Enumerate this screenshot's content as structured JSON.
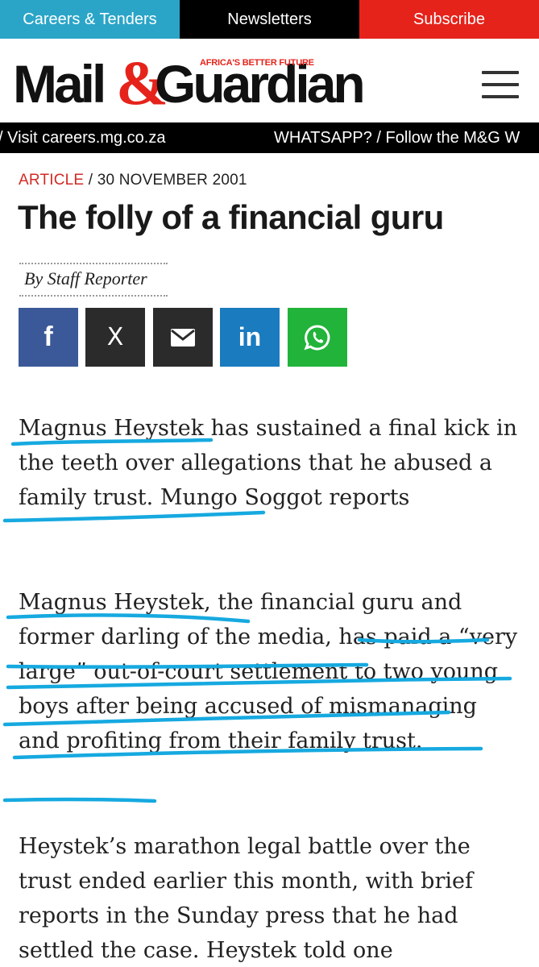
{
  "topbar": {
    "careers": "Careers & Tenders",
    "newsletters": "Newsletters",
    "subscribe": "Subscribe"
  },
  "header": {
    "logo_mail": "Mail",
    "logo_amp": "&",
    "logo_guardian": "Guardian",
    "tagline": "AFRICA'S BETTER FUTURE"
  },
  "ticker": {
    "item1": "/ Visit careers.mg.co.za",
    "item2": "WHATSAPP? / Follow the M&G W"
  },
  "article": {
    "kind": "ARTICLE",
    "separator": "/",
    "date": "30 NOVEMBER 2001",
    "title": "The folly of a financial guru",
    "byline": "By Staff Reporter",
    "paragraphs": [
      "Magnus Heystek has sustained a final kick in the teeth over allegations that he abused a family trust. Mungo Soggot reports",
      "Magnus Heystek, the financial guru and former darling of the media, has paid a “very large” out-of-court settlement to two young boys after being accused of mismanaging and profiting from their family trust.",
      "Heystek’s marathon legal battle over the trust ended earlier this month, with brief reports in the Sunday press that he had settled the case. Heystek told one"
    ]
  },
  "share": {
    "facebook": "f",
    "x": "X",
    "linkedin": "in"
  },
  "colors": {
    "careers_bg": "#2aa5c8",
    "subscribe_bg": "#e5231b",
    "accent_red": "#d32a24",
    "underline_annotation": "#16a9e0"
  }
}
